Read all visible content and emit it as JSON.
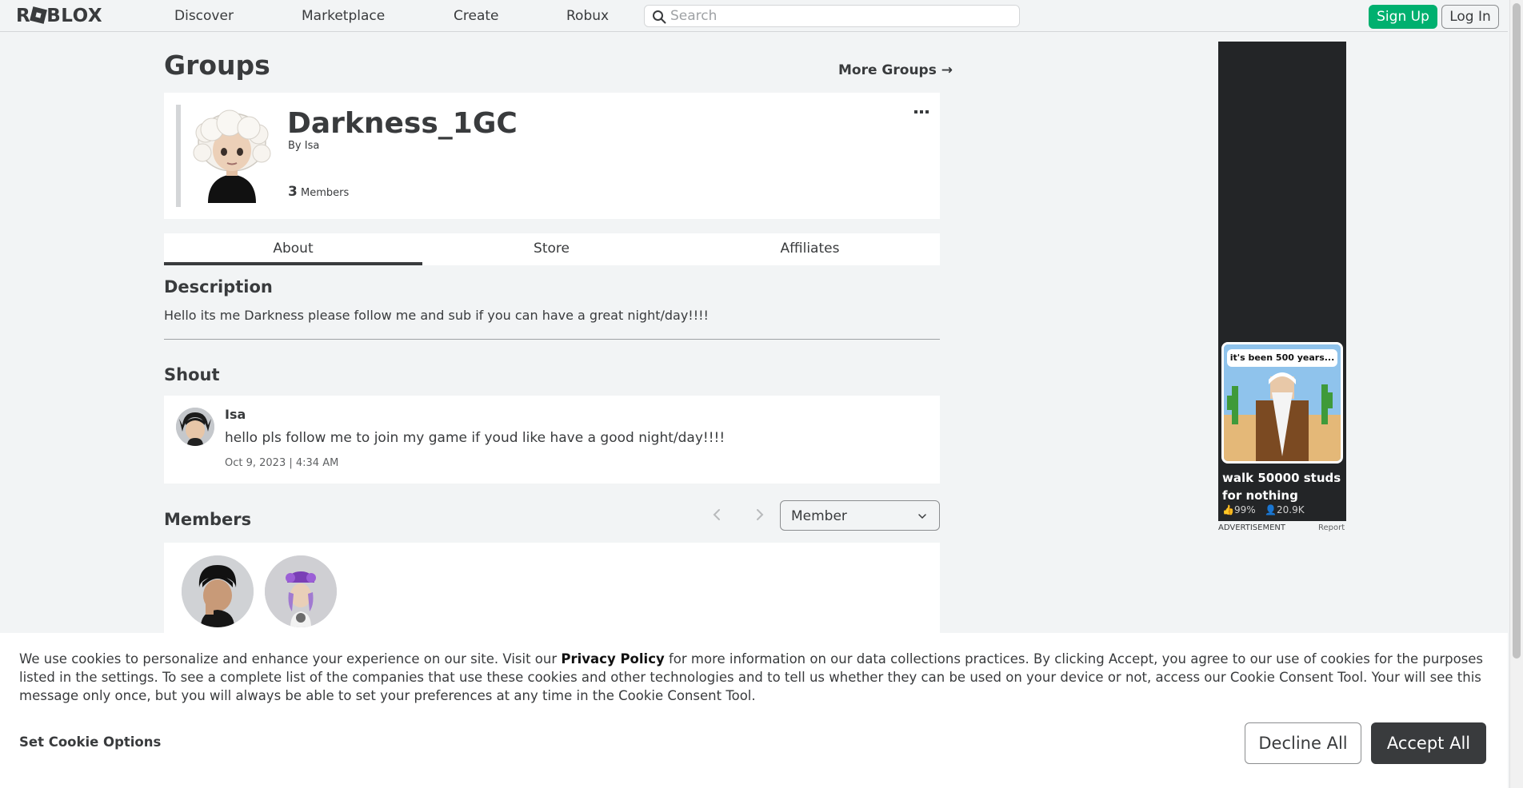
{
  "header": {
    "logo_text": "ROBLOX",
    "nav": [
      "Discover",
      "Marketplace",
      "Create",
      "Robux"
    ],
    "search_placeholder": "Search",
    "signup_label": "Sign Up",
    "login_label": "Log In"
  },
  "page": {
    "title": "Groups",
    "more_groups": "More Groups",
    "more_groups_arrow": "→"
  },
  "group": {
    "name": "Darkness_1GC",
    "by_prefix": "By",
    "owner": "Isa",
    "member_count": "3",
    "members_label": "Members",
    "menu_icon": "ellipsis-icon"
  },
  "tabs": [
    "About",
    "Store",
    "Affiliates"
  ],
  "about": {
    "description_title": "Description",
    "description": "Hello its me Darkness please follow me and sub if you can have a great night/day!!!!",
    "shout_title": "Shout",
    "shout": {
      "author": "Isa",
      "message": "hello pls follow me to join my game if youd like have a good night/day!!!!",
      "date": "Oct 9, 2023 | 4:34 AM"
    },
    "members_title": "Members",
    "role_selected": "Member"
  },
  "ad": {
    "bubble": "it's been 500 years...",
    "headline": "walk 50000 studs for nothing",
    "rating": "99%",
    "players": "20.9K",
    "label": "ADVERTISEMENT",
    "report": "Report"
  },
  "cookie": {
    "text_before": "We use cookies to personalize and enhance your experience on our site. Visit our ",
    "privacy_link": "Privacy Policy",
    "text_after": " for more information on our data collections practices. By clicking Accept, you agree to our use of cookies for the purposes listed in the settings. To see a complete list of the companies that use these cookies and other technologies and to tell us whether they can be used on your device or not, access our Cookie Consent Tool. Your will see this message only once, but you will always be able to set your preferences at any time in the Cookie Consent Tool.",
    "options_label": "Set Cookie Options",
    "decline_label": "Decline All",
    "accept_label": "Accept All"
  },
  "colors": {
    "accent_green": "#00b06f",
    "text_dark": "#393b3d",
    "page_bg": "#f2f4f5"
  }
}
